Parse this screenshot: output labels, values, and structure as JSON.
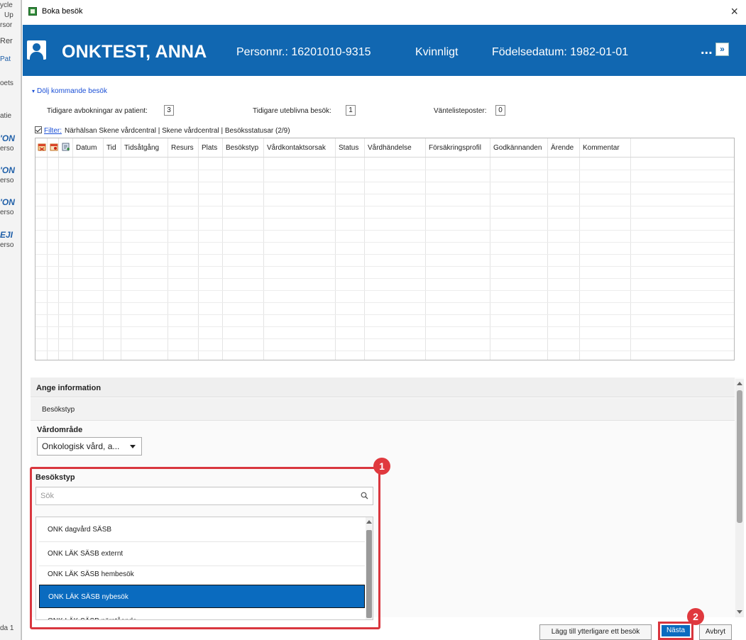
{
  "background_app": {
    "strip_texts": [
      "ycle",
      "Up",
      "rsor",
      "Rer",
      "Pat",
      "oets",
      "atie",
      "'ON",
      "erso",
      "'ON",
      "erso",
      "'ON",
      "erso",
      "EJI",
      "erso",
      "da 1"
    ]
  },
  "window": {
    "title": "Boka besök",
    "close_glyph": "×"
  },
  "patient": {
    "name": "ONKTEST, ANNA",
    "personnr": "Personnr.: 16201010-9315",
    "sex": "Kvinnligt",
    "birthdate": "Födelsedatum: 1982-01-01",
    "more": "...",
    "expand": "»"
  },
  "collapse_link": {
    "arrow": "▾",
    "label": "Dölj kommande besök"
  },
  "counts": {
    "cancellations_label": "Tidigare avbokningar av patient:",
    "cancellations_value": "3",
    "noshows_label": "Tidigare uteblivna besök:",
    "noshows_value": "1",
    "waitlist_label": "Väntelisteposter:",
    "waitlist_value": "0"
  },
  "filter": {
    "link": "Filter:",
    "text": "Närhälsan Skene vårdcentral | Skene vårdcentral | Besöksstatusar (2/9)"
  },
  "grid": {
    "columns": [
      "Datum",
      "Tid",
      "Tidsåtgång",
      "Resurs",
      "Plats",
      "Besökstyp",
      "Vårdkontaktsorsak",
      "Status",
      "Vårdhändelse",
      "Försäkringsprofil",
      "Godkännanden",
      "Ärende",
      "Kommentar"
    ]
  },
  "panel": {
    "section_title": "Ange information",
    "tab_label": "Besökstyp",
    "vardomrade_label": "Vårdområde",
    "vardomrade_value": "Onkologisk vård, a...",
    "besokstyp_label": "Besökstyp",
    "search_placeholder": "Sök",
    "list_items": [
      "ONK dagvård SÄSB",
      "ONK LÄK SÄSB externt",
      "ONK LÄK SÄSB hembesök",
      "ONK LÄK SÄSB nybesök",
      "ONK LÄK SÄSB närstående"
    ],
    "selected_item": "ONK LÄK SÄSB nybesök"
  },
  "annotations": {
    "badge1": "1",
    "badge2": "2"
  },
  "footer": {
    "add_more": "Lägg till ytterligare ett besök",
    "next": "Nästa",
    "cancel": "Avbryt"
  },
  "colors": {
    "header_blue": "#1167b1",
    "selection_blue": "#0a6bbf",
    "highlight_red": "#d9363e"
  }
}
